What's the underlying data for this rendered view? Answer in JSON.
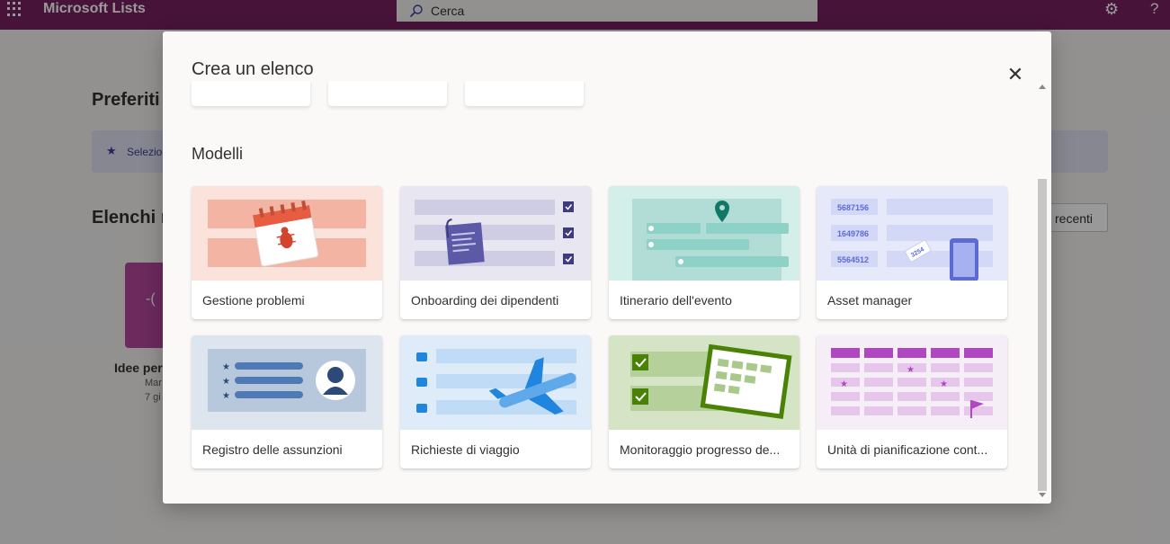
{
  "topbar": {
    "app_title": "Microsoft Lists",
    "search_placeholder": "Cerca",
    "help_label": "?"
  },
  "background": {
    "favorites_heading": "Preferiti",
    "favorites_banner_text": "Selezio",
    "recent_heading": "Elenchi re",
    "recent_button": "recenti",
    "list_name": "Idee per",
    "list_meta_1": "Mar",
    "list_meta_2": "7 gi"
  },
  "modal": {
    "title": "Crea un elenco",
    "section_title": "Modelli",
    "templates": [
      {
        "label": "Gestione problemi"
      },
      {
        "label": "Onboarding dei dipendenti"
      },
      {
        "label": "Itinerario dell'evento"
      },
      {
        "label": "Asset manager",
        "asset_numbers": [
          "5687156",
          "1649786",
          "5564512"
        ],
        "tag_number": "3254"
      },
      {
        "label": "Registro delle assunzioni"
      },
      {
        "label": "Richieste di viaggio"
      },
      {
        "label": "Monitoraggio progresso de..."
      },
      {
        "label": "Unità di pianificazione cont..."
      }
    ]
  },
  "colors": {
    "brand": "#77215f",
    "issue": "#e85c41",
    "onboarding": "#5c5aa7",
    "event": "#117865",
    "asset": "#5c6bd4",
    "recruit": "#2b4a77",
    "travel": "#1f85de",
    "progress": "#498205",
    "planner": "#b146c2"
  }
}
